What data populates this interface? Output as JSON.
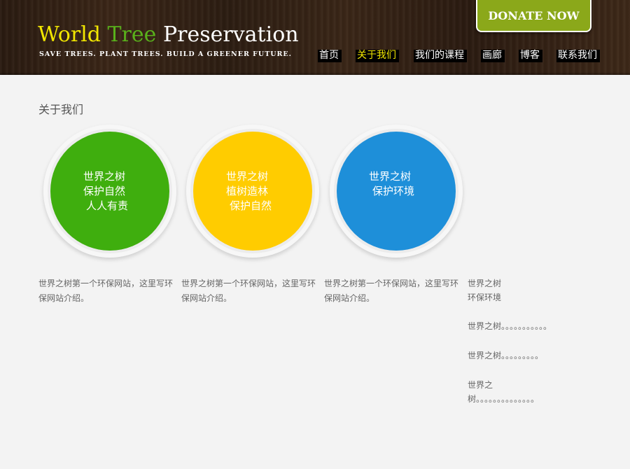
{
  "header": {
    "logo": {
      "word1": "World",
      "word2": "Tree",
      "word3": "Preservation"
    },
    "tagline": "SAVE TREES. PLANT TREES. BUILD A GREENER FUTURE.",
    "donate_label": "DONATE NOW",
    "nav": [
      {
        "label": "首页"
      },
      {
        "label": "关于我们"
      },
      {
        "label": "我们的课程"
      },
      {
        "label": "画廊"
      },
      {
        "label": "博客"
      },
      {
        "label": "联系我们"
      }
    ],
    "active_nav": "关于我们",
    "colors": {
      "yellow": "#f1e600",
      "green": "#59b11b",
      "donate_bg": "#8ba81a"
    }
  },
  "main": {
    "title": "关于我们",
    "circles": [
      {
        "color": "#3fae0e",
        "lines": [
          "世界之树",
          "保护自然",
          "人人有责"
        ]
      },
      {
        "color": "#ffcc00",
        "lines": [
          "世界之树",
          "植树造林",
          "保护自然"
        ]
      },
      {
        "color": "#1e8fd9",
        "lines": [
          "世界之树",
          "保护环境"
        ]
      }
    ],
    "descriptions": [
      "世界之树第一个环保网站，这里写环保网站介绍。",
      "世界之树第一个环保网站，这里写环保网站介绍。",
      "世界之树第一个环保网站，这里写环保网站介绍。"
    ]
  },
  "sidebar": {
    "items": [
      {
        "lines": [
          "世界之树",
          "环保环境"
        ]
      },
      {
        "lines": [
          "世界之树。。。。。。。。。。。"
        ]
      },
      {
        "lines": [
          "世界之树。。。。。。。。。"
        ]
      },
      {
        "lines": [
          "世界之",
          "树。。。。。。。。。。。。。。"
        ]
      }
    ]
  }
}
